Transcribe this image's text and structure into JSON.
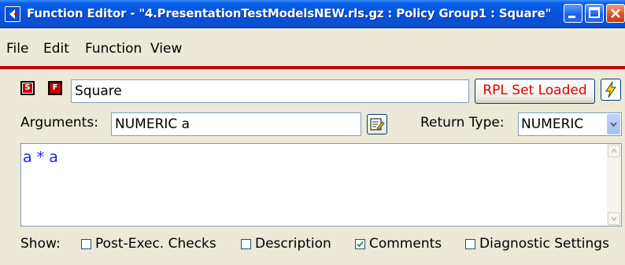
{
  "window": {
    "title": "Function Editor - \"4.PresentationTestModelsNEW.rls.gz : Policy Group1 : Square\"",
    "app_icon": "rpl-app-icon",
    "controls": {
      "minimize": "minimize-icon",
      "maximize": "maximize-icon",
      "close": "close-icon"
    }
  },
  "menu": {
    "items": [
      "File",
      "Edit",
      "Function",
      "View"
    ]
  },
  "function": {
    "s_icon_letter": "S",
    "f_icon_letter": "F",
    "name": "Square",
    "rpl_status": "RPL Set Loaded",
    "arguments_label": "Arguments:",
    "arguments_value": "NUMERIC a",
    "return_type_label": "Return Type:",
    "return_type_value": "NUMERIC",
    "body": "a * a"
  },
  "show": {
    "label": "Show:",
    "options": [
      {
        "label": "Post-Exec. Checks",
        "checked": false
      },
      {
        "label": "Description",
        "checked": false
      },
      {
        "label": "Comments",
        "checked": true
      },
      {
        "label": "Diagnostic Settings",
        "checked": false
      }
    ]
  },
  "colors": {
    "title_blue": "#0553dd",
    "accent_red": "#c00000",
    "code_blue": "#1a1aff",
    "rpl_status_red": "#e00000"
  }
}
